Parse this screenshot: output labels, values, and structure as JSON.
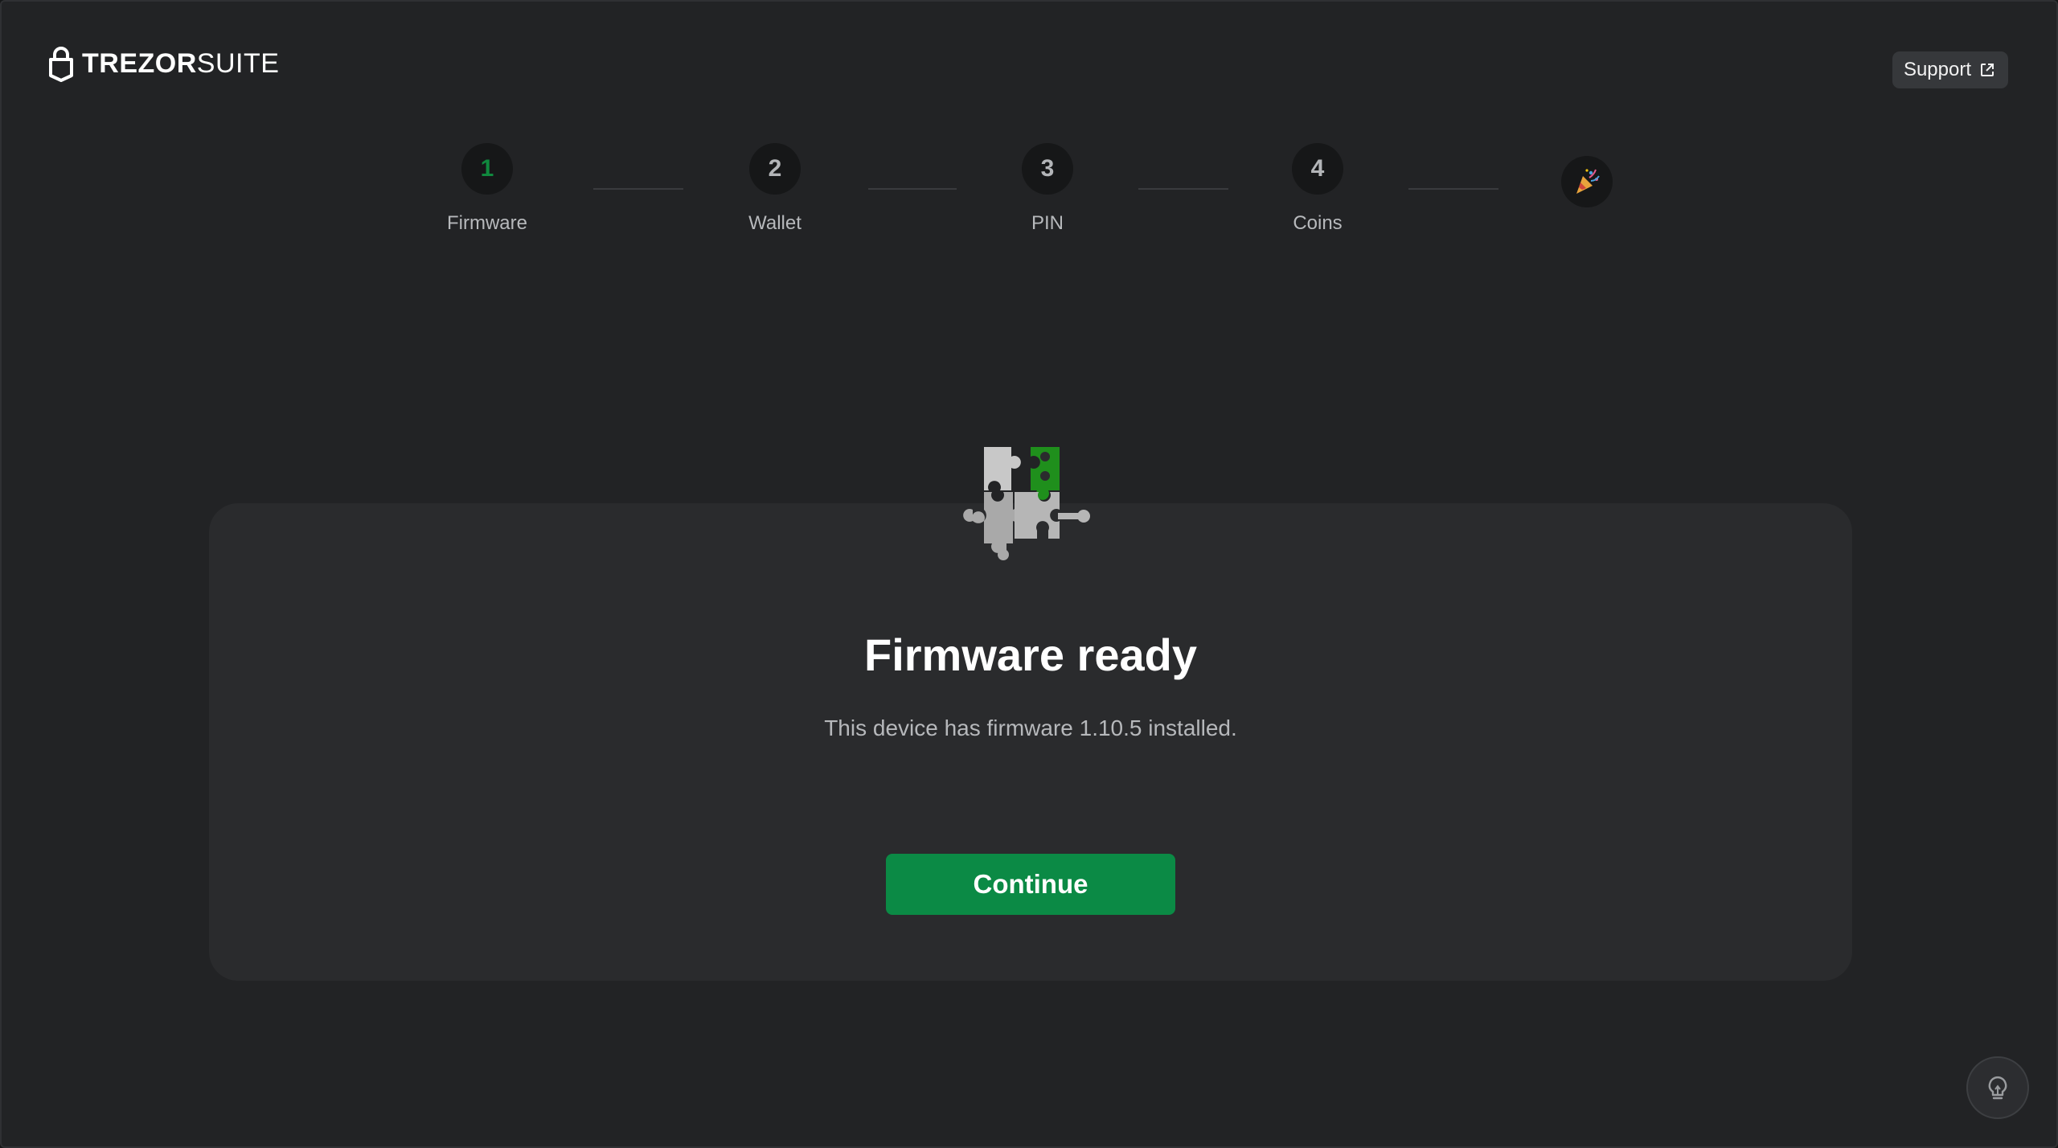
{
  "header": {
    "logo_bold": "TREZOR",
    "logo_light": "SUITE",
    "support_label": "Support"
  },
  "steps": [
    {
      "number": "1",
      "label": "Firmware",
      "active": true
    },
    {
      "number": "2",
      "label": "Wallet",
      "active": false
    },
    {
      "number": "3",
      "label": "PIN",
      "active": false
    },
    {
      "number": "4",
      "label": "Coins",
      "active": false
    }
  ],
  "final_step_icon": "party-popper-icon",
  "main": {
    "title": "Firmware ready",
    "subtitle": "This device has firmware 1.10.5 installed.",
    "continue_label": "Continue"
  },
  "colors": {
    "accent": "#0b8a45",
    "active_step_number": "#10893e",
    "puzzle_green": "#1f8a1a",
    "puzzle_grey": "#bdbdbd"
  },
  "icons": {
    "logo": "lock-icon",
    "support": "external-link-icon",
    "tips": "lightbulb-icon",
    "hero": "puzzle-icon"
  }
}
